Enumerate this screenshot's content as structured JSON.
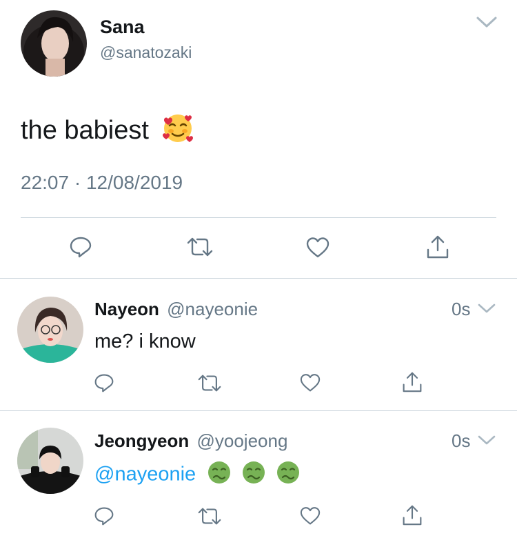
{
  "main_tweet": {
    "name": "Sana",
    "handle": "@sanatozaki",
    "text": "the babiest",
    "emoji": "smiling-face-with-hearts",
    "time": "22:07",
    "separator": "·",
    "date": "12/08/2019"
  },
  "replies": [
    {
      "name": "Nayeon",
      "handle": "@nayeonie",
      "time": "0s",
      "text": "me? i know"
    },
    {
      "name": "Jeongyeon",
      "handle": "@yoojeong",
      "time": "0s",
      "mention": "@nayeonie",
      "emojis": [
        "nauseated-face",
        "nauseated-face",
        "nauseated-face"
      ]
    }
  ],
  "icons": {
    "menu": "chevron-down-icon",
    "reply": "reply-icon",
    "retweet": "retweet-icon",
    "like": "like-icon",
    "share": "share-icon"
  },
  "colors": {
    "text": "#14171a",
    "muted": "#657786",
    "link": "#1da1f2",
    "divider": "#ccd6dd"
  }
}
